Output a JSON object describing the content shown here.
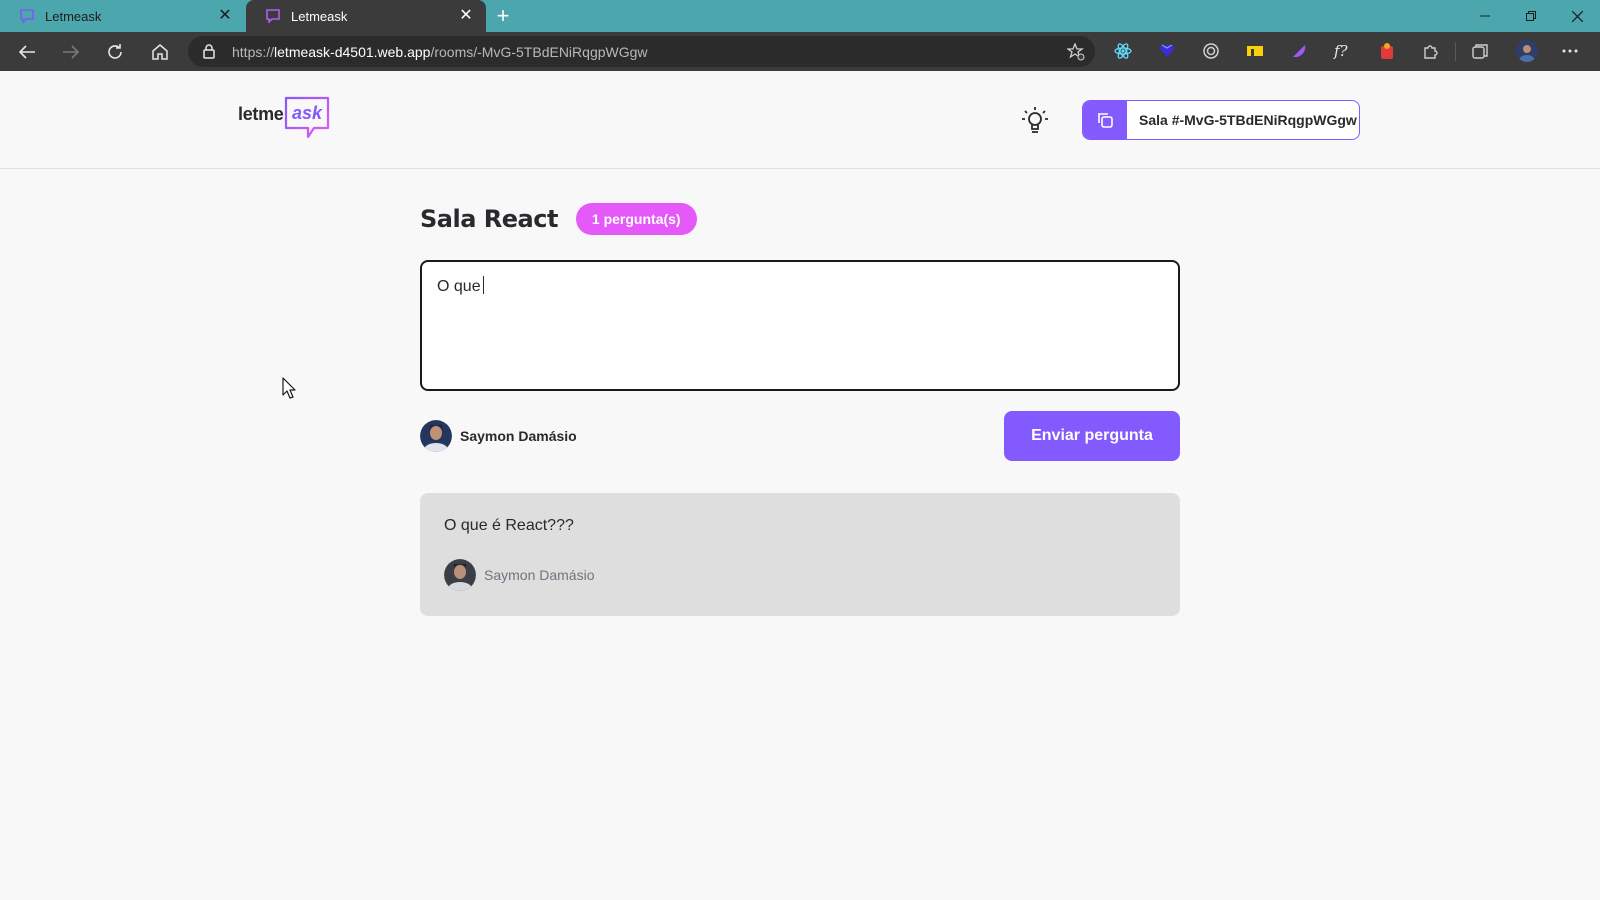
{
  "browser": {
    "tabs": [
      {
        "title": "Letmeask",
        "active": false
      },
      {
        "title": "Letmeask",
        "active": true
      }
    ],
    "url": {
      "prefix": "https://",
      "host": "letmeask-d4501.web.app",
      "path": "/rooms/-MvG-5TBdENiRqgpWGgw"
    },
    "extensions": [
      "react-devtools-icon",
      "extension-diamond-icon",
      "extension-target-icon",
      "extension-yellow-icon",
      "extension-purple-icon",
      "font-ninja-icon",
      "extension-red-icon",
      "extensions-puzzle-icon",
      "collections-icon",
      "profile-avatar",
      "more-menu-icon"
    ]
  },
  "header": {
    "logo_text_1": "letme",
    "logo_text_2": "ask",
    "room_code_label": "Sala #-MvG-5TBdENiRqgpWGgw"
  },
  "room": {
    "title": "Sala React",
    "question_count_label": "1 pergunta(s)"
  },
  "form": {
    "textarea_value": "O que",
    "user_name": "Saymon Damásio",
    "submit_label": "Enviar pergunta"
  },
  "questions": [
    {
      "content": "O que é React???",
      "author": "Saymon Damásio"
    }
  ],
  "colors": {
    "accent": "#835afd",
    "badge": "#e559f9",
    "tabbar": "#4ba6ae",
    "question_bg": "#dededf"
  }
}
